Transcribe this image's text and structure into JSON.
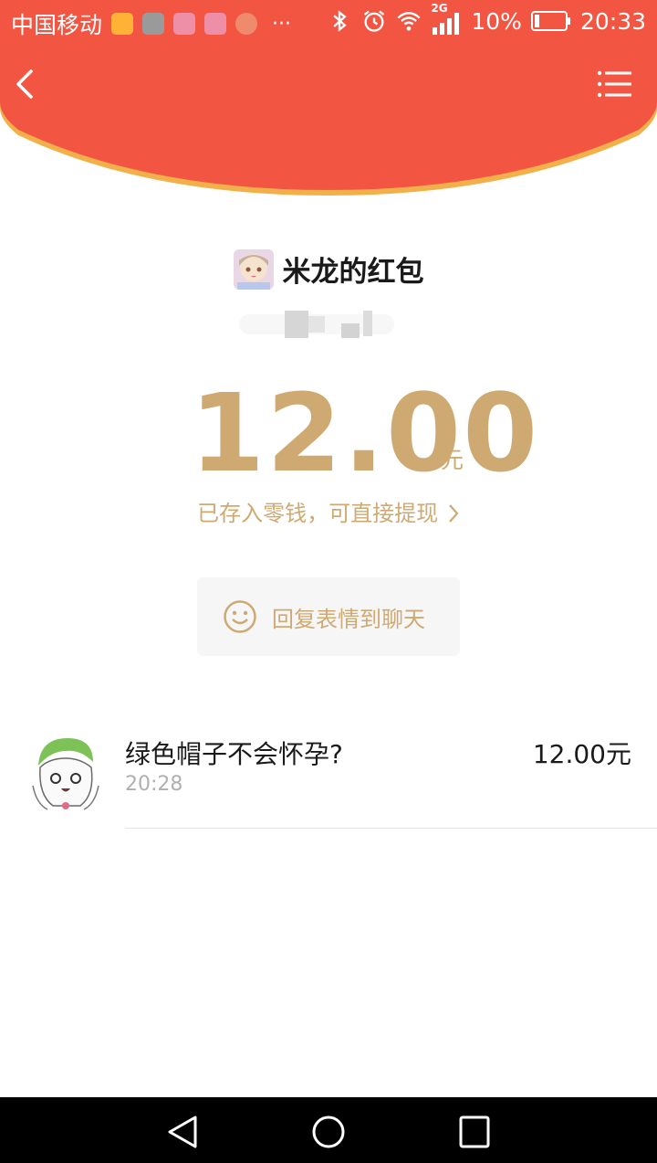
{
  "status_bar": {
    "carrier": "中国移动",
    "more": "···",
    "network": "2G",
    "battery": "10%",
    "time": "20:33"
  },
  "header": {
    "bg_color": "#f25643",
    "edge_color": "#f2b04b"
  },
  "packet": {
    "title": "米龙的红包",
    "amount": "12.00",
    "unit": "元",
    "saved_note": "已存入零钱，可直接提现",
    "reply_label": "回复表情到聊天"
  },
  "receivers": [
    {
      "name": "绿色帽子不会怀孕?",
      "time": "20:28",
      "amount": "12.00元"
    }
  ],
  "colors": {
    "gold": "#cfa972",
    "text": "#1a1a1a",
    "muted": "#b0b0b0"
  },
  "icons": [
    "back-icon",
    "menu-icon",
    "smile-icon",
    "nav-back-icon",
    "nav-home-icon",
    "nav-recent-icon"
  ]
}
